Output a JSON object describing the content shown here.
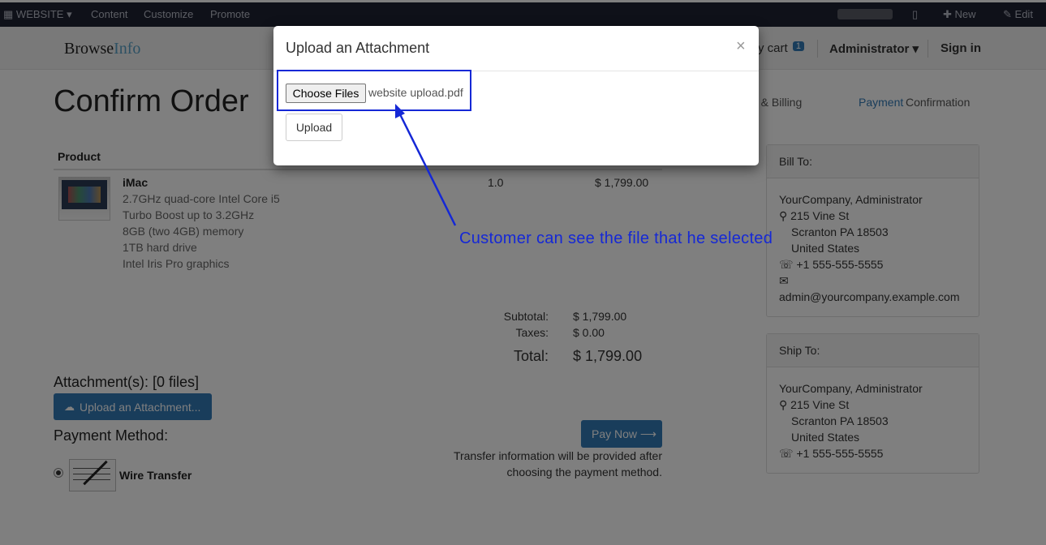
{
  "topbar": {
    "website_label": "WEBSITE",
    "items": [
      "Content",
      "Customize",
      "Promote"
    ],
    "new_label": "New",
    "edit_label": "Edit"
  },
  "navbar": {
    "brand_browse": "Browse",
    "brand_info": "Info",
    "cart_label": "y cart",
    "cart_count": "1",
    "user_label": "Administrator",
    "signin_label": "Sign in"
  },
  "page": {
    "title": "Confirm Order",
    "steps": [
      "g & Billing",
      "Payment",
      "Confirmation"
    ]
  },
  "order": {
    "product_header": "Product",
    "product_name": "iMac",
    "product_desc": [
      "2.7GHz quad-core Intel Core i5",
      "Turbo Boost up to 3.2GHz",
      "8GB (two 4GB) memory",
      "1TB hard drive",
      "Intel Iris Pro graphics"
    ],
    "quantity": "1.0",
    "price": "$ 1,799.00",
    "subtotal_label": "Subtotal:",
    "subtotal_value": "$ 1,799.00",
    "taxes_label": "Taxes:",
    "taxes_value": "$ 0.00",
    "total_label": "Total:",
    "total_value": "$ 1,799.00"
  },
  "attachments": {
    "title": "Attachment(s): [0 files]",
    "button_label": "Upload an Attachment..."
  },
  "payment": {
    "title": "Payment Method:",
    "method_label": "Wire Transfer",
    "pay_now_label": "Pay Now ⟶",
    "transfer_line1": "Transfer information will be provided after",
    "transfer_line2": "choosing the payment method."
  },
  "bill_to": {
    "title": "Bill To:",
    "name": "YourCompany, Administrator",
    "street": "215 Vine St",
    "city": "Scranton PA 18503",
    "country": "United States",
    "phone": "+1 555-555-5555",
    "email": "admin@yourcompany.example.com"
  },
  "ship_to": {
    "title": "Ship To:",
    "name": "YourCompany, Administrator",
    "street": "215 Vine St",
    "city": "Scranton PA 18503",
    "country": "United States",
    "phone": "+1 555-555-5555"
  },
  "modal": {
    "title": "Upload an Attachment",
    "close": "×",
    "choose_files_label": "Choose Files",
    "selected_file": "website upload.pdf",
    "upload_label": "Upload"
  },
  "annotation": {
    "text": "Customer can see the file that he selected",
    "color": "#1528d6"
  },
  "colors": {
    "primary": "#337ab7",
    "topbar": "#1f2233"
  }
}
